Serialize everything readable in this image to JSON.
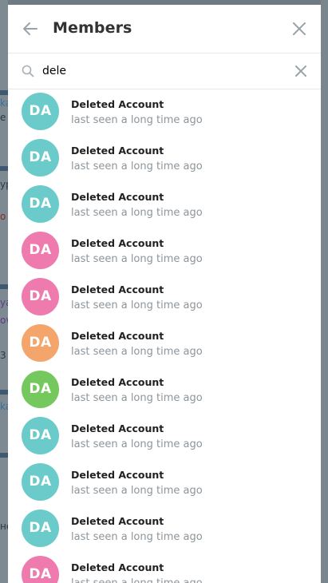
{
  "modal": {
    "title": "Members",
    "back_icon": "arrow-left-icon",
    "close_icon": "close-icon"
  },
  "search": {
    "value": "dele",
    "icon": "search-icon",
    "clear_icon": "clear-icon"
  },
  "colors": {
    "teal": "#6bcbcb",
    "pink": "#ee7aae",
    "orange": "#f4a56b",
    "green": "#75c85e"
  },
  "members": [
    {
      "initials": "DA",
      "name": "Deleted Account",
      "status": "last seen a long time ago",
      "color": "#6bcbcb"
    },
    {
      "initials": "DA",
      "name": "Deleted Account",
      "status": "last seen a long time ago",
      "color": "#6bcbcb"
    },
    {
      "initials": "DA",
      "name": "Deleted Account",
      "status": "last seen a long time ago",
      "color": "#6bcbcb"
    },
    {
      "initials": "DA",
      "name": "Deleted Account",
      "status": "last seen a long time ago",
      "color": "#ee7aae"
    },
    {
      "initials": "DA",
      "name": "Deleted Account",
      "status": "last seen a long time ago",
      "color": "#ee7aae"
    },
    {
      "initials": "DA",
      "name": "Deleted Account",
      "status": "last seen a long time ago",
      "color": "#f4a56b"
    },
    {
      "initials": "DA",
      "name": "Deleted Account",
      "status": "last seen a long time ago",
      "color": "#75c85e"
    },
    {
      "initials": "DA",
      "name": "Deleted Account",
      "status": "last seen a long time ago",
      "color": "#6bcbcb"
    },
    {
      "initials": "DA",
      "name": "Deleted Account",
      "status": "last seen a long time ago",
      "color": "#6bcbcb"
    },
    {
      "initials": "DA",
      "name": "Deleted Account",
      "status": "last seen a long time ago",
      "color": "#6bcbcb"
    },
    {
      "initials": "DA",
      "name": "Deleted Account",
      "status": "last seen a long time ago",
      "color": "#ee7aae"
    }
  ],
  "background": {
    "fragments": [
      "ka",
      "e",
      "yp",
      "o",
      "ya",
      "ov",
      "3",
      "ka",
      "нe"
    ]
  }
}
